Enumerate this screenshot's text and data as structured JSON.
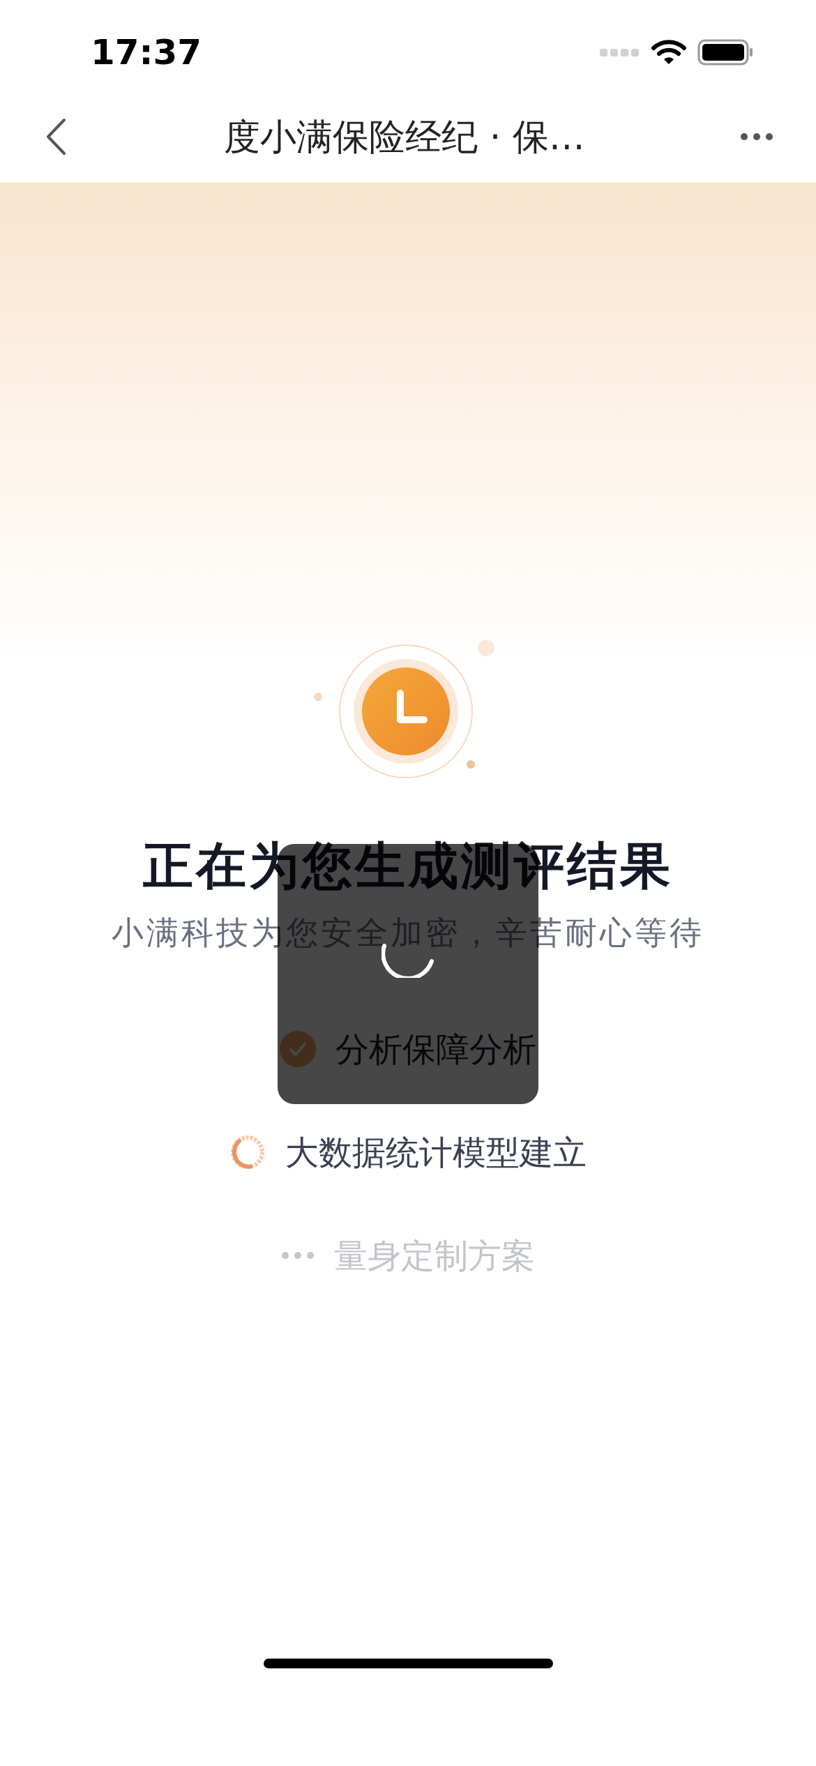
{
  "status_bar": {
    "time": "17:37"
  },
  "nav": {
    "title": "度小满保险经纪 · 保…"
  },
  "heading": "正在为您生成测评结果",
  "subheading": "小满科技为您安全加密，辛苦耐心等待",
  "steps": [
    {
      "kind": "done",
      "label": "分析保障分析"
    },
    {
      "kind": "active",
      "label": "大数据统计模型建立"
    },
    {
      "kind": "pending",
      "label": "量身定制方案"
    }
  ]
}
